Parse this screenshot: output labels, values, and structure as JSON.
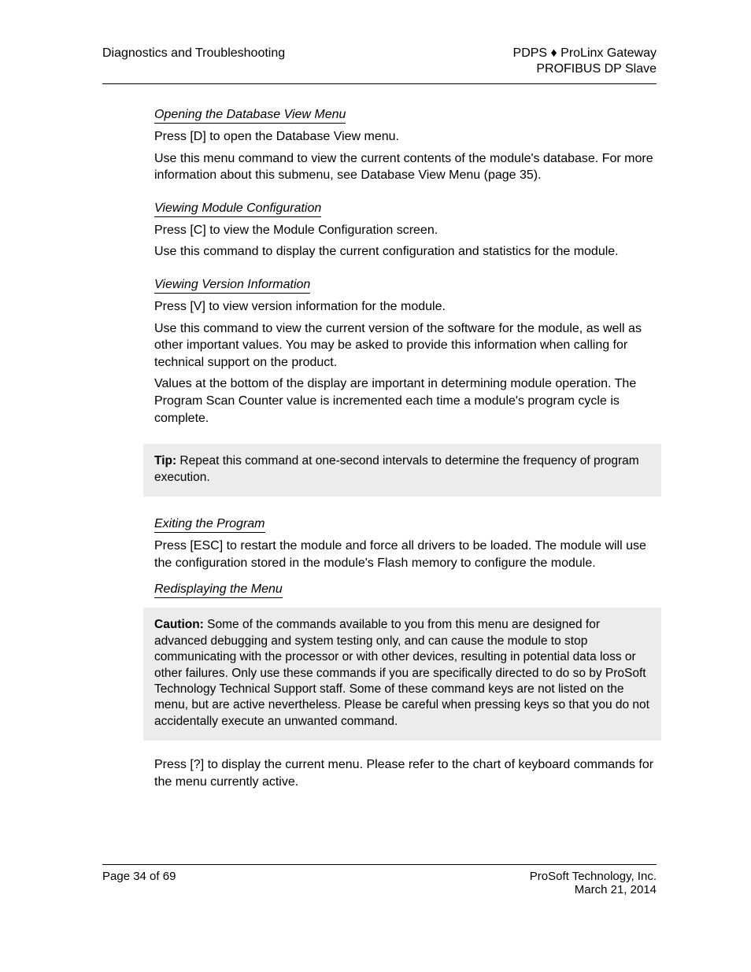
{
  "header": {
    "left": "Diagnostics and Troubleshooting",
    "right1": "PDPS ♦ ProLinx Gateway",
    "right2": "PROFIBUS DP Slave"
  },
  "sections": [
    {
      "heading": "Opening the Database View Menu",
      "body": [
        "Press [D] to open the Database View menu.",
        "Use this menu command to view the current contents of the module's database. For more information about this submenu, see Database View Menu (page 35)."
      ]
    },
    {
      "heading": "Viewing Module Configuration",
      "body": [
        "Press [C] to view the Module Configuration screen.",
        "Use this command to display the current configuration and statistics for the module."
      ]
    },
    {
      "heading": "Viewing Version Information",
      "body": [
        "Press [V] to view version information for the module.",
        "Use this command to view the current version of the software for the module, as well as other important values. You may be asked to provide this information when calling for technical support on the product.",
        "Values at the bottom of the display are important in determining module operation. The Program Scan Counter value is incremented each time a module's program cycle is complete."
      ]
    }
  ],
  "tip": {
    "label": "Tip:",
    "text": " Repeat this command at one-second intervals to determine the frequency of program execution."
  },
  "sections2": [
    {
      "heading": "Exiting the Program",
      "body": [
        "Press [ESC] to restart the module and force all drivers to be loaded. The module will use the configuration stored in the module's Flash memory to configure the module."
      ]
    },
    {
      "heading": "Redisplaying the Menu",
      "body": []
    }
  ],
  "caution": {
    "label": "Caution:",
    "text": " Some of the commands available to you from this menu are designed for advanced debugging and system testing only, and can cause the module to stop communicating with the processor or with other devices, resulting in potential data loss or other failures. Only use these commands if you are specifically directed to do so by ProSoft Technology Technical Support staff. Some of these command keys are not listed on the menu, but are active nevertheless. Please be careful when pressing keys so that you do not accidentally execute an unwanted command."
  },
  "after_caution": "Press [?] to display the current menu. Please refer to the chart of keyboard commands for the menu currently active.",
  "footer": {
    "left1": "Page 34 of 69",
    "right1": "ProSoft Technology, Inc.",
    "right2": "March 21, 2014"
  }
}
